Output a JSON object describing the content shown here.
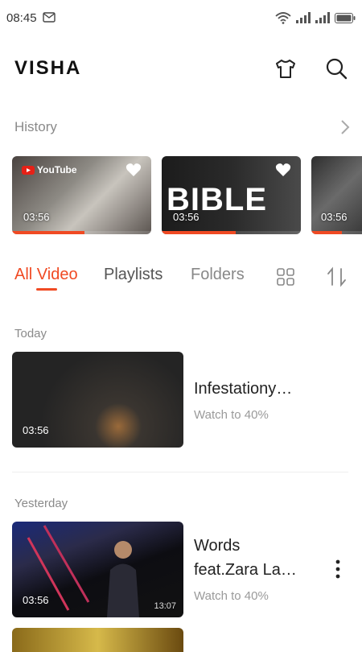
{
  "status": {
    "time": "08:45"
  },
  "app": {
    "logo_text": "VISHA"
  },
  "history": {
    "title": "History",
    "items": [
      {
        "duration": "03:56",
        "favorited": true,
        "progress": 0.52,
        "badge": "YouTube"
      },
      {
        "duration": "03:56",
        "favorited": true,
        "progress": 0.53,
        "badge": "BIBLE"
      },
      {
        "duration": "03:56",
        "favorited": false,
        "progress": 0.6
      }
    ]
  },
  "tabs": [
    {
      "label": "All Video",
      "active": true
    },
    {
      "label": "Playlists",
      "active": false
    },
    {
      "label": "Folders",
      "active": false
    }
  ],
  "sections": [
    {
      "label": "Today",
      "videos": [
        {
          "title": "Infestationy…",
          "subtitle": "Watch to 40%",
          "duration": "03:56"
        }
      ]
    },
    {
      "label": "Yesterday",
      "videos": [
        {
          "title": "Words",
          "title2": "feat.Zara La…",
          "subtitle": "Watch to 40%",
          "duration": "03:56",
          "time_right": "13:07"
        }
      ]
    }
  ],
  "colors": {
    "accent": "#f04a23"
  }
}
